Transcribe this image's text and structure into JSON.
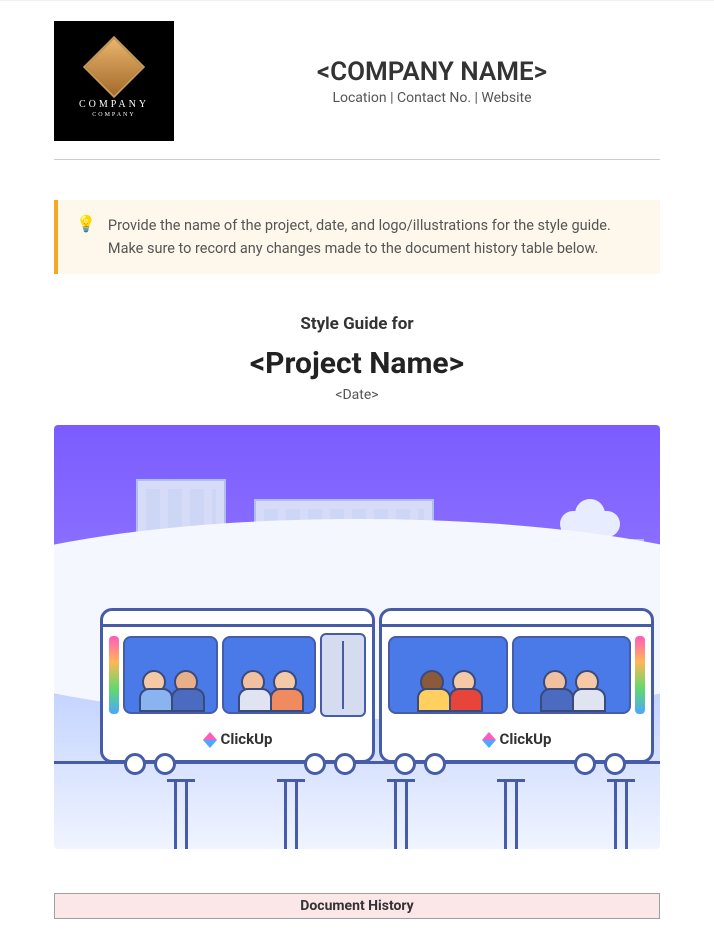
{
  "header": {
    "logo_text": "COMPANY",
    "logo_sub": "COMPANY",
    "company_name": "<COMPANY NAME>",
    "company_sub": "Location | Contact No. | Website"
  },
  "callout": {
    "text": "Provide the name of the project, date, and logo/illustrations for the style guide. Make sure to record any changes made to the document history table below."
  },
  "title_block": {
    "style_for": "Style Guide for",
    "project_name": "<Project Name>",
    "date": "<Date>"
  },
  "illustration": {
    "brand_label": "ClickUp"
  },
  "history": {
    "header": "Document History"
  }
}
